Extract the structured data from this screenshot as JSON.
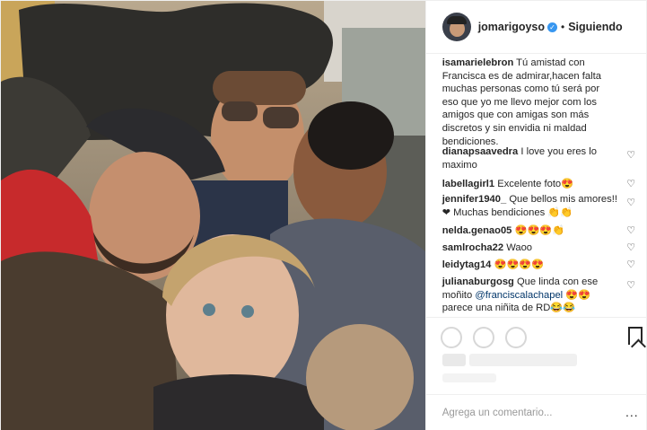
{
  "post": {
    "header": {
      "username": "jomarigoyso",
      "verified_glyph": "✓",
      "separator": "•",
      "follow_label": "Siguiendo"
    },
    "photo": {
      "icon": "group-selfie-photo"
    },
    "comments": [
      {
        "user": "isamarielebron",
        "text": " Tú amistad con Francisca es de admirar,hacen falta muchas personas como tú será por eso que yo me llevo mejor com los amigos que con amigas son más discretos y sin envidia ni maldad bendiciones."
      },
      {
        "user": "dianapsaavedra",
        "text": " I love you eres lo maximo"
      },
      {
        "user": "labellagirl1",
        "text": " Excelente foto😍"
      },
      {
        "user": "jennifer1940_",
        "text": " Que bellos mis amores!!❤ Muchas bendiciones 👏👏"
      },
      {
        "user": "nelda.genao05",
        "text": " 😍😍😍👏"
      },
      {
        "user": "samlrocha22",
        "text": " Waoo"
      },
      {
        "user": "leidytag14",
        "text": " 😍😍😍😍"
      },
      {
        "user": "julianaburgosg",
        "text_before": " Que linda con ese moñito ",
        "mention": "@franciscalachapel",
        "text_after": " 😍😍 parece una niñita de RD😂😂"
      }
    ],
    "heart_glyph": "♡",
    "add_comment": {
      "placeholder": "Agrega un comentario...",
      "more_glyph": "..."
    },
    "colors": {
      "link": "#003569",
      "verified": "#3897f0",
      "border": "#efefef"
    }
  }
}
